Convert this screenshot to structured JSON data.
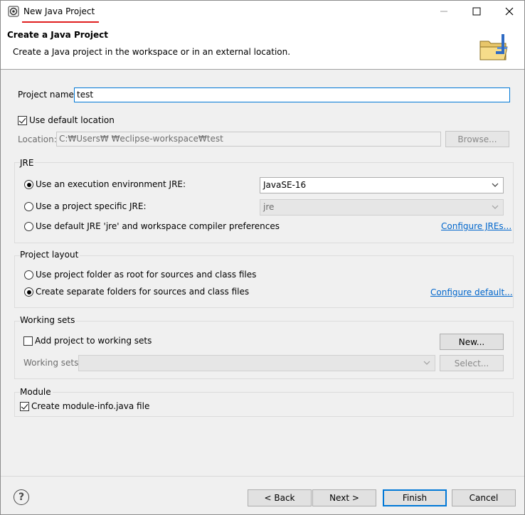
{
  "titlebar": {
    "title": "New Java Project",
    "minimize_icon": "minimize-icon",
    "maximize_icon": "maximize-icon",
    "close_icon": "close-icon"
  },
  "banner": {
    "title": "Create a Java Project",
    "description": "Create a Java project in the workspace or in an external location."
  },
  "project": {
    "name_label": "Project name:",
    "name_value": "test",
    "use_default_location_label": "Use default location",
    "use_default_location_checked": true,
    "location_label": "Location:",
    "location_value": "C:₩Users₩     ₩eclipse-workspace₩test",
    "browse_label": "Browse..."
  },
  "jre": {
    "group_title": "JRE",
    "option_env_label": "Use an execution environment JRE:",
    "option_env_value": "JavaSE-16",
    "option_specific_label": "Use a project specific JRE:",
    "option_specific_value": "jre",
    "option_default_label": "Use default JRE 'jre' and workspace compiler preferences",
    "configure_link": "Configure JREs...",
    "selected": "env"
  },
  "layout": {
    "group_title": "Project layout",
    "option_root_label": "Use project folder as root for sources and class files",
    "option_separate_label": "Create separate folders for sources and class files",
    "configure_link": "Configure default...",
    "selected": "separate"
  },
  "working_sets": {
    "group_title": "Working sets",
    "add_label": "Add project to working sets",
    "new_label": "New...",
    "sets_label": "Working sets:",
    "select_label": "Select..."
  },
  "module": {
    "group_title": "Module",
    "create_label": "Create module-info.java file",
    "checked": true
  },
  "footer": {
    "help_icon": "help-icon",
    "help_glyph": "?",
    "back_label": "< Back",
    "next_label": "Next >",
    "finish_label": "Finish",
    "cancel_label": "Cancel"
  }
}
